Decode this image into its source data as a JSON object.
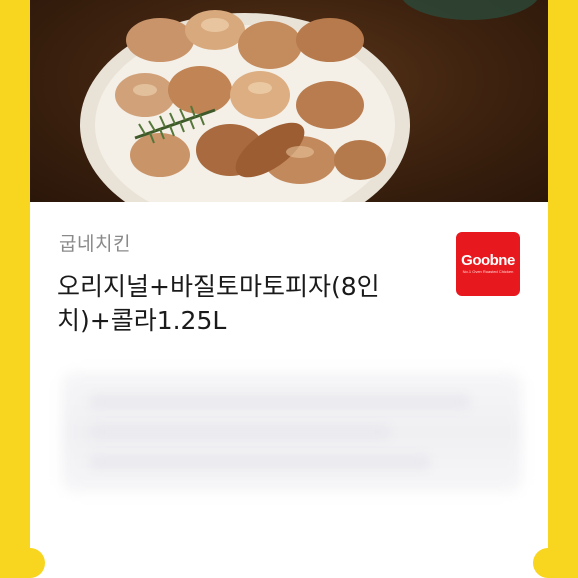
{
  "product": {
    "brand": "굽네치킨",
    "name": "오리지널+바질토마토피자(8인\n치)+콜라1.25L"
  },
  "logo": {
    "word": "Goobne",
    "tagline": "No.1 Oven Roasted Chicken",
    "color": "#e8191e"
  },
  "colors": {
    "background": "#f8d51f",
    "card": "#ffffff"
  }
}
